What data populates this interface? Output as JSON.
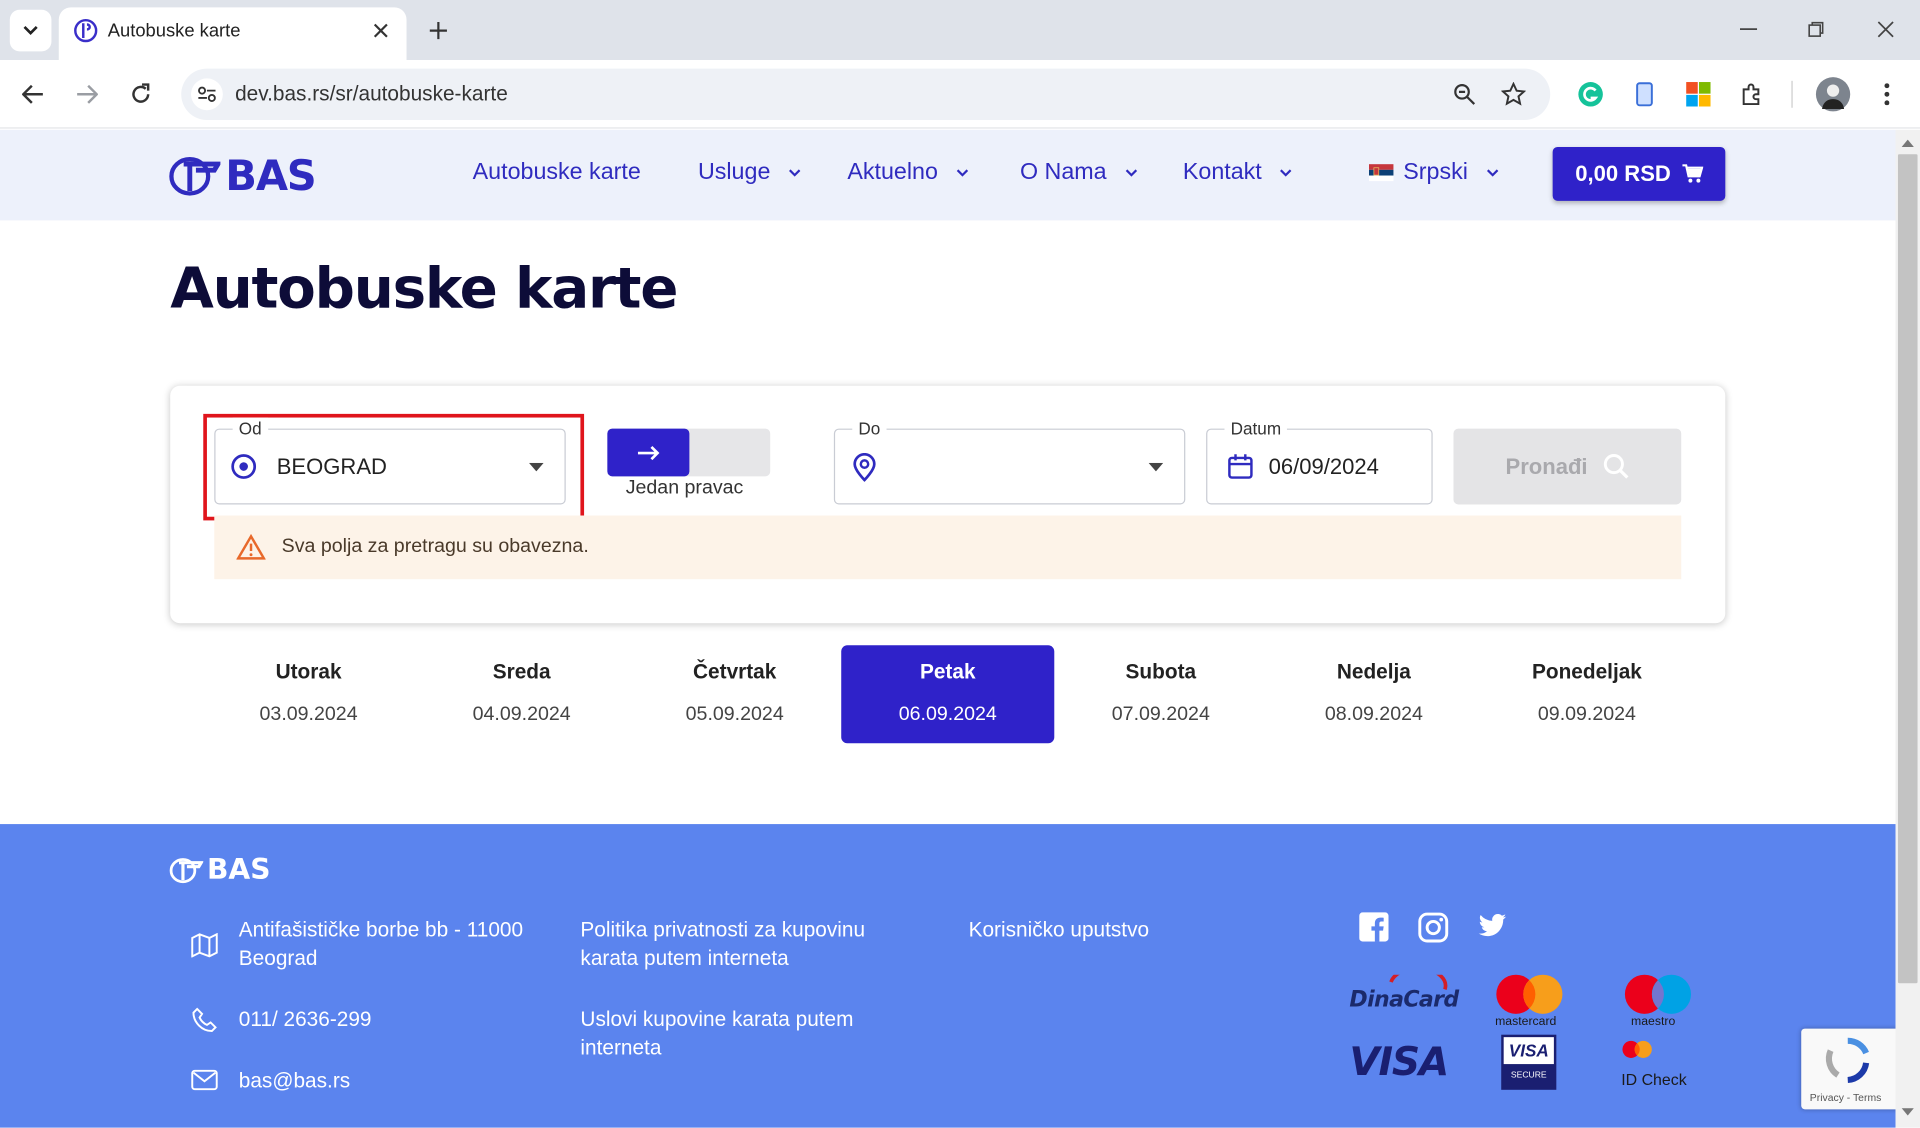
{
  "browser": {
    "tab_title": "Autobuske karte",
    "url": "dev.bas.rs/sr/autobuske-karte"
  },
  "header": {
    "logo_text": "BAS",
    "nav": [
      "Autobuske karte",
      "Usluge",
      "Aktuelno",
      "O Nama",
      "Kontakt"
    ],
    "language": "Srpski",
    "cart": "0,00 RSD"
  },
  "page": {
    "title": "Autobuske karte"
  },
  "search": {
    "from_label": "Od",
    "from_value": "BEOGRAD",
    "direction_label": "Jedan pravac",
    "to_label": "Do",
    "to_value": "",
    "date_label": "Datum",
    "date_value": "06/09/2024",
    "search_button": "Pronađi",
    "warning": "Sva polja za pretragu su obavezna."
  },
  "days": [
    {
      "name": "Utorak",
      "date": "03.09.2024",
      "selected": false
    },
    {
      "name": "Sreda",
      "date": "04.09.2024",
      "selected": false
    },
    {
      "name": "Četvrtak",
      "date": "05.09.2024",
      "selected": false
    },
    {
      "name": "Petak",
      "date": "06.09.2024",
      "selected": true
    },
    {
      "name": "Subota",
      "date": "07.09.2024",
      "selected": false
    },
    {
      "name": "Nedelja",
      "date": "08.09.2024",
      "selected": false
    },
    {
      "name": "Ponedeljak",
      "date": "09.09.2024",
      "selected": false
    }
  ],
  "footer": {
    "logo_text": "BAS",
    "address": "Antifašističke borbe bb - 11000 Beograd",
    "phone": "011/ 2636-299",
    "email": "bas@bas.rs",
    "link_privacy": "Politika privatnosti za kupovinu karata putem interneta",
    "link_terms": "Uslovi kupovine karata putem interneta",
    "link_manual": "Korisničko uputstvo",
    "payment": {
      "dinacard": "DinaCard",
      "mastercard": "mastercard",
      "maestro": "maestro",
      "visa": "VISA",
      "visa_secure_1": "VISA",
      "visa_secure_2": "SECURE",
      "id_check": "ID Check"
    },
    "recaptcha": "Privacy - Terms"
  },
  "colors": {
    "brand": "#2f22c9",
    "footer": "#5b84ee",
    "warning_bg": "#fdf3e8",
    "highlight": "#e0151c"
  }
}
